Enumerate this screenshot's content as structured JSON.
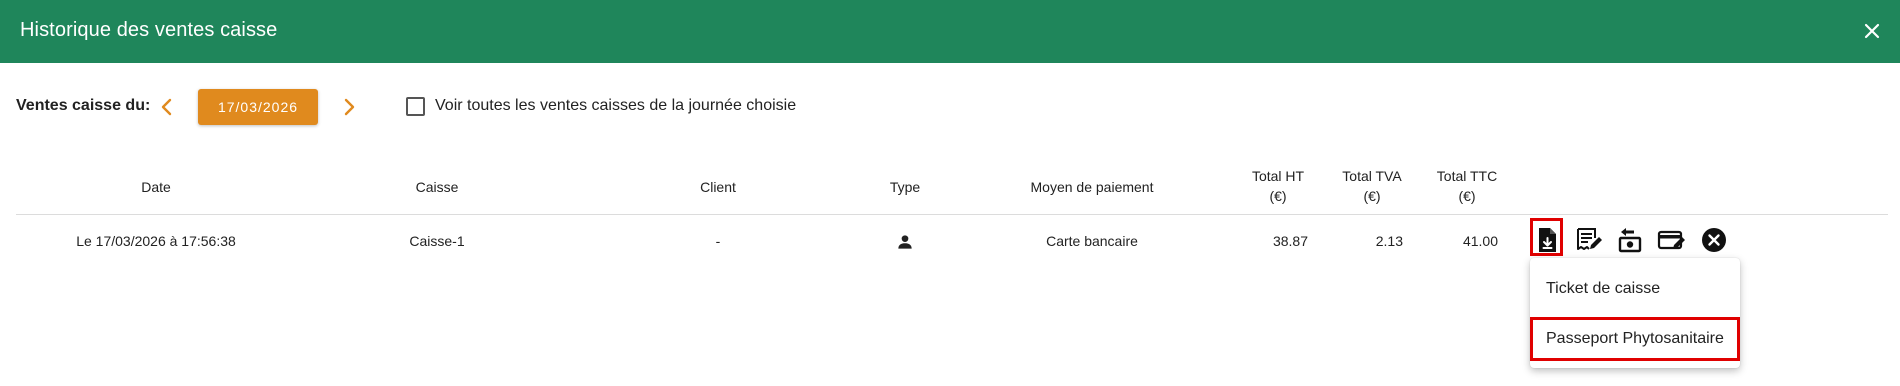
{
  "dialog": {
    "title": "Historique des ventes caisse"
  },
  "toolbar": {
    "ventes_label": "Ventes caisse du:",
    "date": "17/03/2026",
    "checkbox_label": "Voir toutes les ventes caisses de la journée choisie",
    "checkbox_checked": false
  },
  "table": {
    "headers": {
      "date": "Date",
      "caisse": "Caisse",
      "client": "Client",
      "type": "Type",
      "moyen": "Moyen de paiement",
      "total_ht": "Total HT",
      "total_ht_unit": "(€)",
      "total_tva": "Total TVA",
      "total_tva_unit": "(€)",
      "total_ttc": "Total TTC",
      "total_ttc_unit": "(€)"
    },
    "rows": [
      {
        "date": "Le 17/03/2026 à 17:56:38",
        "caisse": "Caisse-1",
        "client": "-",
        "type_icon": "person-icon",
        "moyen": "Carte bancaire",
        "total_ht": "38.87",
        "total_tva": "2.13",
        "total_ttc": "41.00"
      }
    ]
  },
  "actions": [
    "download-document-icon",
    "edit-receipt-icon",
    "cash-return-icon",
    "edit-card-icon",
    "cancel-icon"
  ],
  "dropdown": {
    "items": [
      "Ticket de caisse",
      "Passeport Phytosanitaire"
    ]
  },
  "colors": {
    "header": "#1f865b",
    "accent": "#e08a1e",
    "highlight": "#e00000"
  }
}
